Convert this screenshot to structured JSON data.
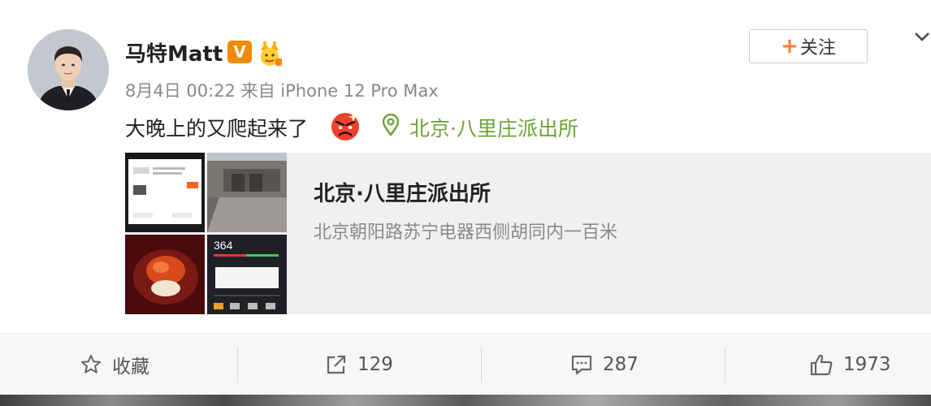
{
  "user": {
    "name": "马特Matt",
    "verified_badge": "V",
    "avatar_icon": "avatar-man-in-suit",
    "crown_icon": "golden-crown-emoji-icon"
  },
  "post": {
    "date": "8月4日 00:22",
    "source": "来自 iPhone 12 Pro Max",
    "text": "大晚上的又爬起来了",
    "emoji": "angry-face-emoji",
    "location": "北京·八里庄派出所"
  },
  "follow_button": {
    "plus": "+",
    "label": "关注"
  },
  "location_card": {
    "title": "北京·八里庄派出所",
    "address": "北京朝阳路苏宁电器西侧胡同内一百米",
    "thumb_aqi": "364"
  },
  "actions": {
    "favorite": {
      "label": "收藏",
      "icon": "star-icon"
    },
    "repost": {
      "count": "129",
      "icon": "share-icon"
    },
    "comment": {
      "count": "287",
      "icon": "comment-icon"
    },
    "like": {
      "count": "1973",
      "icon": "thumbs-up-icon"
    }
  },
  "colors": {
    "accent_orange": "#fa7d3c",
    "location_green": "#6ea338",
    "verified_orange": "#f08a00",
    "card_bg": "#f0f0f3"
  }
}
